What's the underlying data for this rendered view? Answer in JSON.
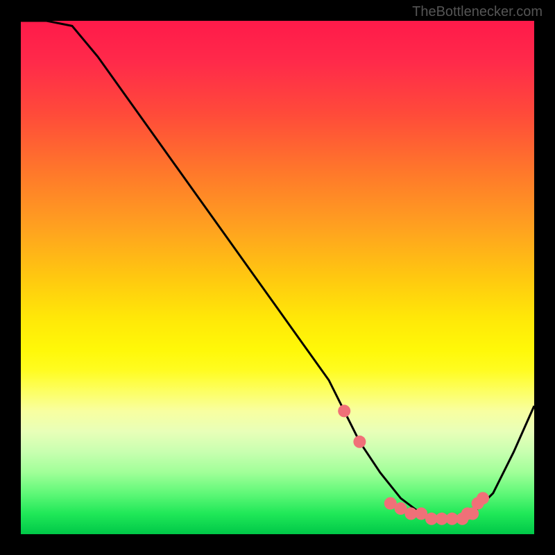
{
  "watermark": "TheBottlenecker.com",
  "chart_data": {
    "type": "line",
    "title": "",
    "xlabel": "",
    "ylabel": "",
    "xlim": [
      0,
      100
    ],
    "ylim": [
      0,
      100
    ],
    "series": [
      {
        "name": "bottleneck-curve",
        "x": [
          0,
          5,
          10,
          15,
          20,
          25,
          30,
          35,
          40,
          45,
          50,
          55,
          60,
          63,
          66,
          70,
          74,
          78,
          82,
          86,
          88,
          92,
          96,
          100
        ],
        "y": [
          100,
          100,
          99,
          93,
          86,
          79,
          72,
          65,
          58,
          51,
          44,
          37,
          30,
          24,
          18,
          12,
          7,
          4,
          3,
          3,
          4,
          8,
          16,
          25
        ]
      }
    ],
    "markers": {
      "name": "highlight-points",
      "x": [
        63,
        66,
        72,
        74,
        76,
        78,
        80,
        82,
        84,
        86,
        87,
        88,
        89,
        90
      ],
      "y": [
        24,
        18,
        6,
        5,
        4,
        4,
        3,
        3,
        3,
        3,
        4,
        4,
        6,
        7
      ]
    },
    "colors": {
      "curve": "#000000",
      "marker": "#f07078",
      "gradient_top": "#ff1a4a",
      "gradient_mid": "#fff808",
      "gradient_bottom": "#00c848"
    }
  }
}
